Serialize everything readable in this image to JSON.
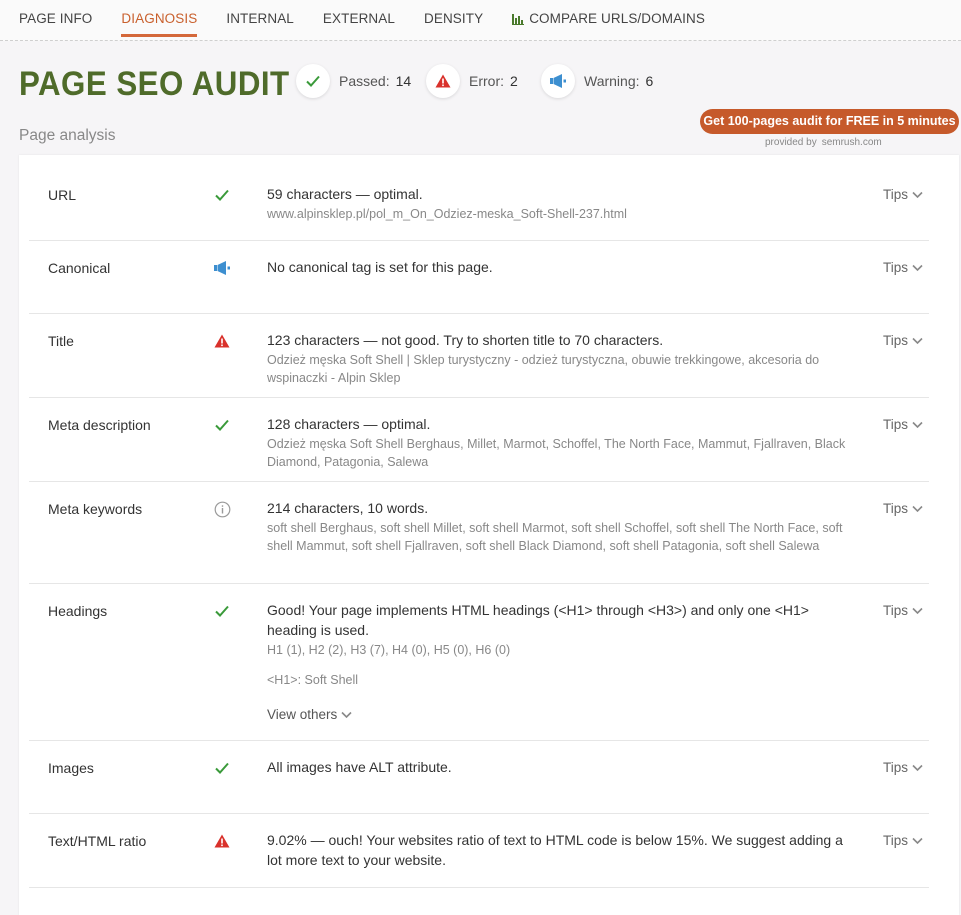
{
  "nav": {
    "tabs": [
      {
        "label": "PAGE INFO"
      },
      {
        "label": "DIAGNOSIS"
      },
      {
        "label": "INTERNAL"
      },
      {
        "label": "EXTERNAL"
      },
      {
        "label": "DENSITY"
      },
      {
        "label": "COMPARE URLS/DOMAINS"
      }
    ]
  },
  "header": {
    "title": "PAGE SEO AUDIT",
    "passed_label": "Passed:",
    "passed_value": "14",
    "error_label": "Error:",
    "error_value": "2",
    "warning_label": "Warning:",
    "warning_value": "6",
    "cta": "Get 100-pages audit for FREE in 5 minutes",
    "provided_by": "provided by",
    "provider": "semrush.com"
  },
  "section_title": "Page analysis",
  "tips_label": "Tips",
  "colors": {
    "pass": "#3a9a3a",
    "error": "#d9312b",
    "warning": "#3d8fd0",
    "accent": "#c65a2b",
    "title": "#4f6b2a"
  },
  "rows": [
    {
      "label": "URL",
      "status": "check-icon",
      "main": "59 characters — optimal.",
      "sub": "www.alpinsklep.pl/pol_m_On_Odziez-meska_Soft-Shell-237.html"
    },
    {
      "label": "Canonical",
      "status": "megaphone-icon",
      "main": "No canonical tag is set for this page."
    },
    {
      "label": "Title",
      "status": "error-icon",
      "main": "123 characters — not good. Try to shorten title to 70 characters.",
      "sub": "Odzież męska Soft Shell | Sklep turystyczny - odzież turystyczna, obuwie trekkingowe, akcesoria do wspinaczki - Alpin Sklep"
    },
    {
      "label": "Meta description",
      "status": "check-icon",
      "main": "128 characters — optimal.",
      "sub": "Odzież męska Soft Shell Berghaus, Millet, Marmot, Schoffel, The North Face, Mammut, Fjallraven, Black Diamond, Patagonia, Salewa"
    },
    {
      "label": "Meta keywords",
      "status": "info-icon",
      "main": "214 characters, 10 words.",
      "sub": "soft shell Berghaus, soft shell Millet, soft shell Marmot, soft shell Schoffel, soft shell The North Face, soft shell Mammut, soft shell Fjallraven, soft shell Black Diamond, soft shell Patagonia, soft shell Salewa"
    },
    {
      "label": "Headings",
      "status": "check-icon",
      "main": "Good! Your page implements HTML headings (<H1> through <H3>) and only one <H1> heading is used.",
      "sub": "H1 (1), H2 (2), H3 (7), H4 (0), H5 (0), H6 (0)",
      "sub2": "<H1>: Soft Shell",
      "view_others": "View others"
    },
    {
      "label": "Images",
      "status": "check-icon",
      "main": "All images have ALT attribute."
    },
    {
      "label": "Text/HTML ratio",
      "status": "error-icon",
      "main": "9.02% — ouch! Your websites ratio of text to HTML code is below 15%. We suggest adding a lot more text to your website."
    }
  ]
}
